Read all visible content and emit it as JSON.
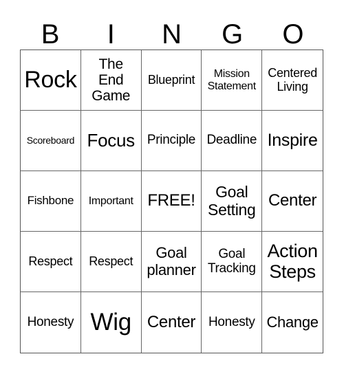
{
  "header": [
    "B",
    "I",
    "N",
    "G",
    "O"
  ],
  "cells": [
    "Rock",
    "The\nEnd\nGame",
    "Blueprint",
    "Mission\nStatement",
    "Centered\nLiving",
    "Scoreboard",
    "Focus",
    "Principle",
    "Deadline",
    "Inspire",
    "Fishbone",
    "Important",
    "FREE!",
    "Goal\nSetting",
    "Center",
    "Respect",
    "Respect",
    "Goal\nplanner",
    "Goal\nTracking",
    "Action\nSteps",
    "Honesty",
    "Wig",
    "Center",
    "Honesty",
    "Change"
  ]
}
